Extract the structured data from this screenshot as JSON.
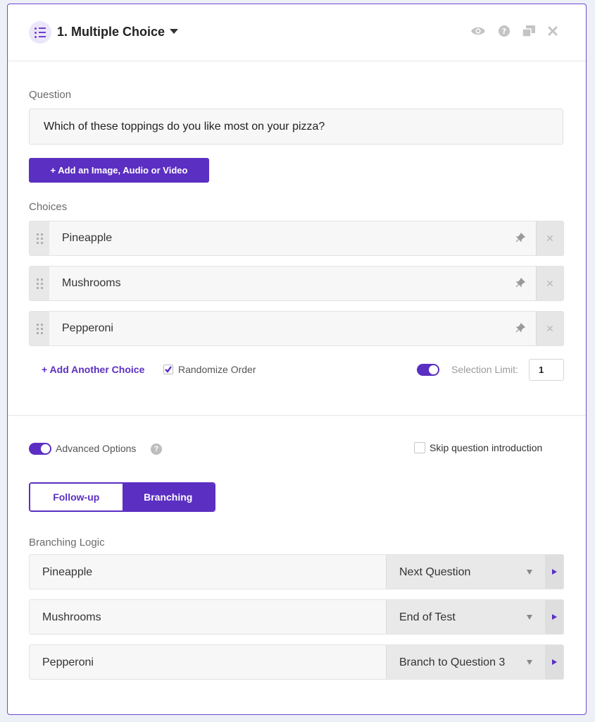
{
  "header": {
    "title": "1. Multiple Choice",
    "type_icon": "list-icon",
    "actions": [
      "eye-icon",
      "help-icon",
      "duplicate-icon",
      "close-icon"
    ]
  },
  "question": {
    "label": "Question",
    "value": "Which of these toppings do you like most on your pizza?"
  },
  "media_button": "+ Add an Image, Audio or Video",
  "choices": {
    "label": "Choices",
    "items": [
      "Pineapple",
      "Mushrooms",
      "Pepperoni"
    ],
    "add_label": "+ Add Another Choice",
    "randomize_label": "Randomize Order",
    "randomize_checked": true,
    "selection_limit_enabled": true,
    "selection_limit_label": "Selection Limit:",
    "selection_limit_value": "1"
  },
  "advanced": {
    "label": "Advanced Options",
    "enabled": true,
    "help": "?",
    "skip_intro_label": "Skip question introduction",
    "skip_intro_checked": false
  },
  "tabs": {
    "follow_up": "Follow-up",
    "branching": "Branching",
    "active": "Branching"
  },
  "branching": {
    "label": "Branching Logic",
    "rows": [
      {
        "choice": "Pineapple",
        "target": "Next Question"
      },
      {
        "choice": "Mushrooms",
        "target": "End of Test"
      },
      {
        "choice": "Pepperoni",
        "target": "Branch to Question 3"
      }
    ]
  },
  "colors": {
    "accent": "#5b2fc2",
    "border": "#6c4bd1",
    "background": "#eef0f8"
  }
}
